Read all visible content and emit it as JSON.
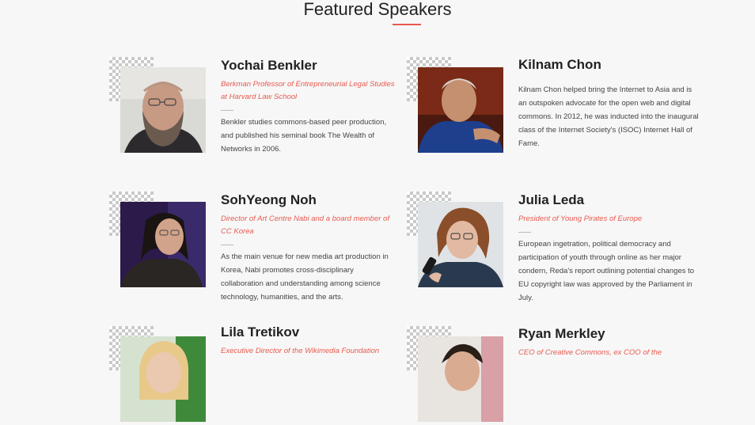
{
  "section": {
    "title": "Featured Speakers"
  },
  "speakers": [
    {
      "name": "Yochai Benkler",
      "role": "Berkman Professor of Entrepreneurial Legal Studies at Harvard Law School",
      "bio": "Benkler studies commons-based peer production, and published his seminal book The Wealth of Networks in 2006."
    },
    {
      "name": "Kilnam Chon",
      "role": "",
      "bio": "Kilnam Chon helped bring the Internet to Asia and is an outspoken advocate for the open web and digital commons. In 2012, he was inducted into the inaugural class of the Internet Society's (ISOC) Internet Hall of Fame."
    },
    {
      "name": "SohYeong Noh",
      "role": "Director of Art Centre Nabi and a board member of CC Korea",
      "bio": "As the main venue for new media art production in Korea, Nabi promotes cross-disciplinary collaboration and understanding among science technology, humanities, and the arts."
    },
    {
      "name": "Julia Leda",
      "role": "President of Young Pirates of Europe",
      "bio": "European ingetration, political democracy and participation of youth through online as her major condern, Reda's report outlining potential changes to EU copyright law was approved by the Parliament in July."
    },
    {
      "name": "Lila Tretikov",
      "role": "Executive Director of the Wikimedia Foundation",
      "bio": ""
    },
    {
      "name": "Ryan Merkley",
      "role": "CEO of Creative Commons, ex COO of the",
      "bio": ""
    }
  ]
}
